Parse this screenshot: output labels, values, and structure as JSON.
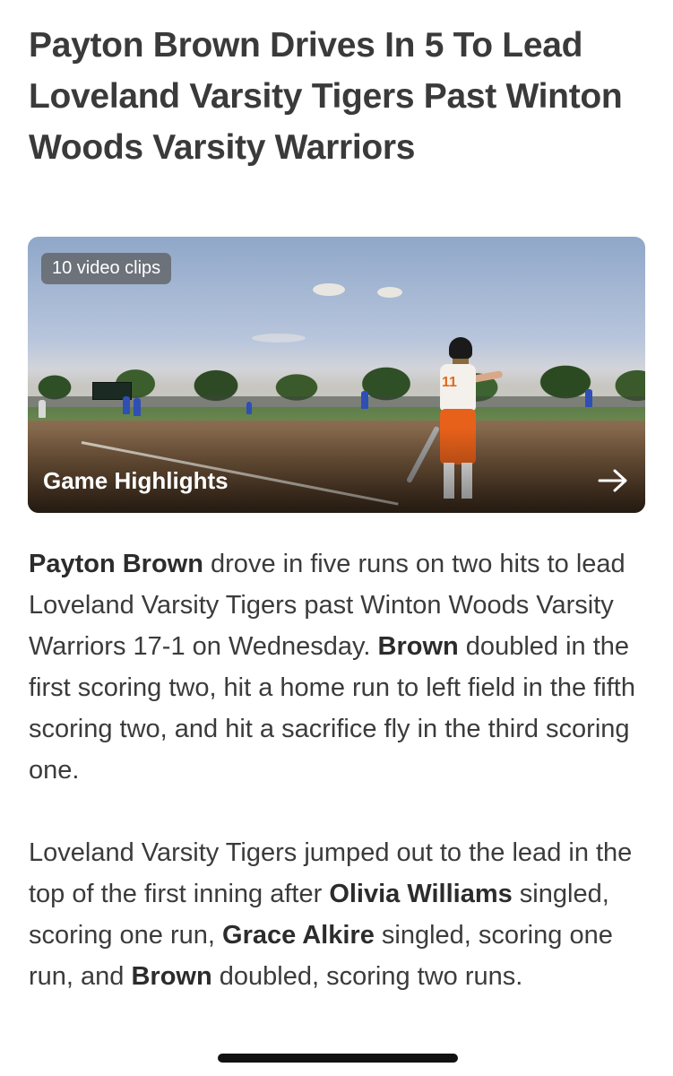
{
  "headline": "Payton Brown Drives In 5 To Lead Loveland Varsity Tigers Past Winton Woods Varsity Warriors",
  "video": {
    "clips_badge": "10 video clips",
    "title": "Game Highlights",
    "arrow_icon": "arrow-right-icon",
    "jersey_number": "11"
  },
  "article": {
    "p1": {
      "b1": "Payton Brown",
      "t1": " drove in five runs on two hits to lead Loveland Varsity Tigers past Winton Woods Varsity Warriors 17-1 on Wednesday. ",
      "b2": "Brown",
      "t2": " doubled in the first scoring two, hit a home run to left field in the fifth scoring two, and hit a sacrifice fly in the third scoring one."
    },
    "p2": {
      "t1": "Loveland Varsity Tigers jumped out to the lead in the top of the first inning after ",
      "b1": "Olivia Williams",
      "t2": " singled, scoring one run, ",
      "b2": "Grace Alkire",
      "t3": " singled, scoring one run, and ",
      "b3": "Brown",
      "t4": " doubled, scoring two runs."
    }
  }
}
